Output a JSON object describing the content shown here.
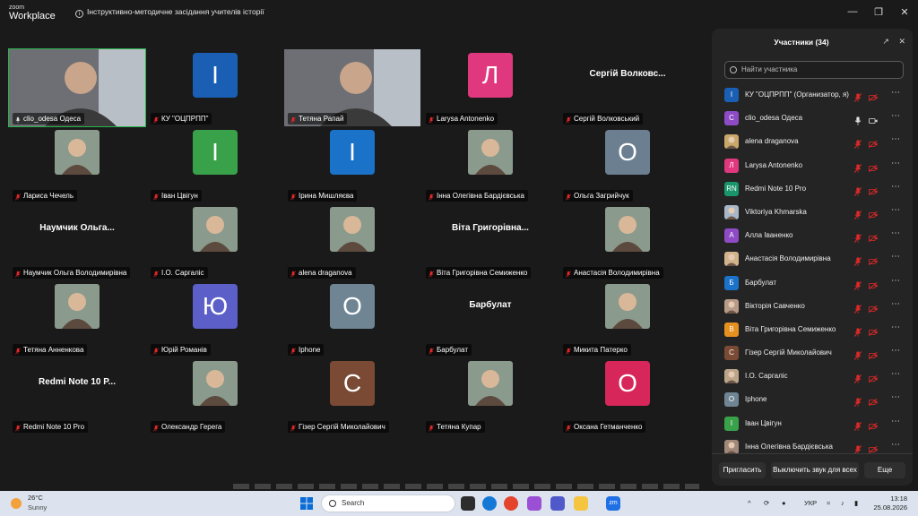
{
  "app": {
    "brand_top": "zoom",
    "brand_bottom": "Workplace",
    "meeting_title": "Інструктивно-методичне засідання учителів історії"
  },
  "window_controls": [
    "minimize-icon",
    "restore-icon",
    "close-icon"
  ],
  "tiles": [
    {
      "name": "clio_odesa Одеса",
      "type": "video",
      "active": true,
      "mic": "on"
    },
    {
      "name": "КУ \"ОЦПРПП\"",
      "type": "letter",
      "letter": "І",
      "color": "#1a5fb4",
      "mic": "muted"
    },
    {
      "name": "Тетяна Рапай",
      "type": "video",
      "mic": "muted"
    },
    {
      "name": "Larysa Antonenko",
      "type": "letter",
      "letter": "Л",
      "color": "#e0387e",
      "mic": "muted"
    },
    {
      "name": "Сергій Волковський",
      "type": "bigname",
      "big": "Сергій Волковс...",
      "mic": "muted"
    },
    {
      "name": "Лариса Чечель",
      "type": "photo",
      "mic": "muted"
    },
    {
      "name": "Іван Цвігун",
      "type": "letter",
      "letter": "І",
      "color": "#3aa14b",
      "mic": "muted"
    },
    {
      "name": "Ірина Мишляєва",
      "type": "letter",
      "letter": "І",
      "color": "#1a72c9",
      "mic": "muted"
    },
    {
      "name": "Інна Олегівна Бардієвська",
      "type": "photo",
      "mic": "muted"
    },
    {
      "name": "Ольга Загрийчук",
      "type": "letter",
      "letter": "О",
      "color": "#6b7f91",
      "mic": "muted"
    },
    {
      "name": "Наумчик Ольга Володимирівна",
      "type": "bigname",
      "big": "Наумчик  Ольга...",
      "mic": "muted"
    },
    {
      "name": "І.О. Саргаліс",
      "type": "photo",
      "mic": "muted"
    },
    {
      "name": "alena draganova",
      "type": "photo",
      "mic": "muted"
    },
    {
      "name": "Віта Григорівна  Семиженко",
      "type": "bigname",
      "big": "Віта Григорівна...",
      "mic": "muted"
    },
    {
      "name": "Анастасія Володимирівна",
      "type": "photo",
      "mic": "muted"
    },
    {
      "name": "Тетяна Анненкова",
      "type": "photo",
      "mic": "muted"
    },
    {
      "name": "Юрій Романів",
      "type": "letter",
      "letter": "Ю",
      "color": "#5b5fc7",
      "mic": "muted"
    },
    {
      "name": "Iphone",
      "type": "letter",
      "letter": "О",
      "color": "#6f8594",
      "mic": "muted"
    },
    {
      "name": "Барбулат",
      "type": "bigname",
      "big": "Барбулат",
      "mic": "muted"
    },
    {
      "name": "Микита Патерко",
      "type": "photo",
      "mic": "muted"
    },
    {
      "name": "Redmi Note 10 Pro",
      "type": "bigname",
      "big": "Redmi Note 10 P...",
      "mic": "muted"
    },
    {
      "name": "Олександр Герега",
      "type": "photo",
      "mic": "muted"
    },
    {
      "name": "Гізер Сергій Миколайович",
      "type": "letter",
      "letter": "С",
      "color": "#7a4a34",
      "mic": "muted"
    },
    {
      "name": "Тетяна Купар",
      "type": "photo",
      "mic": "muted"
    },
    {
      "name": "Оксана Гетманченко",
      "type": "letter",
      "letter": "О",
      "color": "#d7265a",
      "mic": "muted"
    }
  ],
  "participants_panel": {
    "title": "Участники (34)",
    "search_placeholder": "Найти участника",
    "participants": [
      {
        "name": "КУ \"ОЦПРПП\" (Организатор, я)",
        "avatar": "І",
        "color": "#1a5fb4",
        "mic": "muted"
      },
      {
        "name": "clio_odesa Одеса",
        "avatar": "C",
        "color": "#8e4bc5",
        "mic": "on"
      },
      {
        "name": "alena draganova",
        "avatar": "",
        "color": "#c9a86a",
        "mic": "muted"
      },
      {
        "name": "Larysa Antonenko",
        "avatar": "Л",
        "color": "#e0387e",
        "mic": "muted"
      },
      {
        "name": "Redmi Note 10 Pro",
        "avatar": "RN",
        "color": "#18956b",
        "mic": "muted"
      },
      {
        "name": "Viktoriya Khmarska",
        "avatar": "",
        "color": "#a8b6c8",
        "mic": "muted"
      },
      {
        "name": "Алла Іваненко",
        "avatar": "А",
        "color": "#8e4bc5",
        "mic": "muted"
      },
      {
        "name": "Анастасія Володимирівна",
        "avatar": "",
        "color": "#d2b48c",
        "mic": "muted"
      },
      {
        "name": "Барбулат",
        "avatar": "Б",
        "color": "#1a72c9",
        "mic": "muted"
      },
      {
        "name": "Вікторія Савченко",
        "avatar": "",
        "color": "#b89a88",
        "mic": "muted"
      },
      {
        "name": "Віта Григорівна  Семиженко",
        "avatar": "В",
        "color": "#e6901f",
        "mic": "muted"
      },
      {
        "name": "Гізер Сергій Миколайович",
        "avatar": "С",
        "color": "#7a4a34",
        "mic": "muted"
      },
      {
        "name": "І.О. Саргаліс",
        "avatar": "",
        "color": "#bca58a",
        "mic": "muted"
      },
      {
        "name": "Iphone",
        "avatar": "О",
        "color": "#6f8594",
        "mic": "muted"
      },
      {
        "name": "Іван Цвігун",
        "avatar": "І",
        "color": "#3aa14b",
        "mic": "muted"
      },
      {
        "name": "Інна Олегівна Бардієвська",
        "avatar": "",
        "color": "#a0887a",
        "mic": "muted"
      }
    ],
    "footer": {
      "invite": "Пригласить",
      "mute_all": "Выключить звук для всех",
      "more": "Еще"
    }
  },
  "taskbar": {
    "weather_temp": "26°C",
    "weather_cond": "Sunny",
    "search_placeholder": "Search",
    "language": "УКР",
    "time": "13:18",
    "date": "25.08.2026"
  }
}
